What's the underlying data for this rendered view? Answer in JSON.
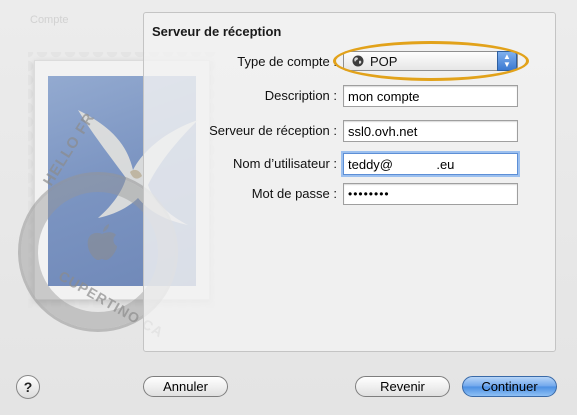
{
  "background": {
    "ghost_label": "Compte"
  },
  "stamp": {
    "postmark_top": "HELLO FR",
    "postmark_bottom": "CUPERTINO CA"
  },
  "panel": {
    "title": "Serveur de réception"
  },
  "form": {
    "account_type": {
      "label": "Type de compte :",
      "value": "POP",
      "icon": "globe-icon"
    },
    "description": {
      "label": "Description :",
      "value": "mon compte"
    },
    "incoming_server": {
      "label": "Serveur de réception :",
      "value": "ssl0.ovh.net"
    },
    "username": {
      "label": "Nom d’utilisateur :",
      "value": "teddy@            .eu"
    },
    "password": {
      "label": "Mot de passe :",
      "value": "••••••••"
    }
  },
  "buttons": {
    "help": "?",
    "cancel": "Annuler",
    "back": "Revenir",
    "continue": "Continuer"
  },
  "colors": {
    "highlight": "#e2a21a",
    "focus_ring": "#9cc0ef",
    "primary_button": "#4b8fe3"
  }
}
